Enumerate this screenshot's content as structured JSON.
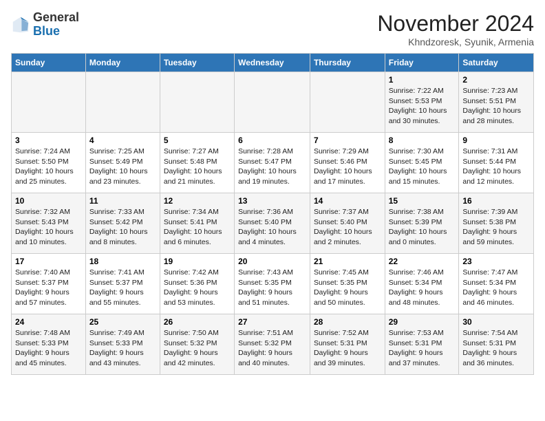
{
  "header": {
    "logo_general": "General",
    "logo_blue": "Blue",
    "month": "November 2024",
    "location": "Khndzoresk, Syunik, Armenia"
  },
  "columns": [
    "Sunday",
    "Monday",
    "Tuesday",
    "Wednesday",
    "Thursday",
    "Friday",
    "Saturday"
  ],
  "weeks": [
    [
      {
        "day": "",
        "info": ""
      },
      {
        "day": "",
        "info": ""
      },
      {
        "day": "",
        "info": ""
      },
      {
        "day": "",
        "info": ""
      },
      {
        "day": "",
        "info": ""
      },
      {
        "day": "1",
        "info": "Sunrise: 7:22 AM\nSunset: 5:53 PM\nDaylight: 10 hours and 30 minutes."
      },
      {
        "day": "2",
        "info": "Sunrise: 7:23 AM\nSunset: 5:51 PM\nDaylight: 10 hours and 28 minutes."
      }
    ],
    [
      {
        "day": "3",
        "info": "Sunrise: 7:24 AM\nSunset: 5:50 PM\nDaylight: 10 hours and 25 minutes."
      },
      {
        "day": "4",
        "info": "Sunrise: 7:25 AM\nSunset: 5:49 PM\nDaylight: 10 hours and 23 minutes."
      },
      {
        "day": "5",
        "info": "Sunrise: 7:27 AM\nSunset: 5:48 PM\nDaylight: 10 hours and 21 minutes."
      },
      {
        "day": "6",
        "info": "Sunrise: 7:28 AM\nSunset: 5:47 PM\nDaylight: 10 hours and 19 minutes."
      },
      {
        "day": "7",
        "info": "Sunrise: 7:29 AM\nSunset: 5:46 PM\nDaylight: 10 hours and 17 minutes."
      },
      {
        "day": "8",
        "info": "Sunrise: 7:30 AM\nSunset: 5:45 PM\nDaylight: 10 hours and 15 minutes."
      },
      {
        "day": "9",
        "info": "Sunrise: 7:31 AM\nSunset: 5:44 PM\nDaylight: 10 hours and 12 minutes."
      }
    ],
    [
      {
        "day": "10",
        "info": "Sunrise: 7:32 AM\nSunset: 5:43 PM\nDaylight: 10 hours and 10 minutes."
      },
      {
        "day": "11",
        "info": "Sunrise: 7:33 AM\nSunset: 5:42 PM\nDaylight: 10 hours and 8 minutes."
      },
      {
        "day": "12",
        "info": "Sunrise: 7:34 AM\nSunset: 5:41 PM\nDaylight: 10 hours and 6 minutes."
      },
      {
        "day": "13",
        "info": "Sunrise: 7:36 AM\nSunset: 5:40 PM\nDaylight: 10 hours and 4 minutes."
      },
      {
        "day": "14",
        "info": "Sunrise: 7:37 AM\nSunset: 5:40 PM\nDaylight: 10 hours and 2 minutes."
      },
      {
        "day": "15",
        "info": "Sunrise: 7:38 AM\nSunset: 5:39 PM\nDaylight: 10 hours and 0 minutes."
      },
      {
        "day": "16",
        "info": "Sunrise: 7:39 AM\nSunset: 5:38 PM\nDaylight: 9 hours and 59 minutes."
      }
    ],
    [
      {
        "day": "17",
        "info": "Sunrise: 7:40 AM\nSunset: 5:37 PM\nDaylight: 9 hours and 57 minutes."
      },
      {
        "day": "18",
        "info": "Sunrise: 7:41 AM\nSunset: 5:37 PM\nDaylight: 9 hours and 55 minutes."
      },
      {
        "day": "19",
        "info": "Sunrise: 7:42 AM\nSunset: 5:36 PM\nDaylight: 9 hours and 53 minutes."
      },
      {
        "day": "20",
        "info": "Sunrise: 7:43 AM\nSunset: 5:35 PM\nDaylight: 9 hours and 51 minutes."
      },
      {
        "day": "21",
        "info": "Sunrise: 7:45 AM\nSunset: 5:35 PM\nDaylight: 9 hours and 50 minutes."
      },
      {
        "day": "22",
        "info": "Sunrise: 7:46 AM\nSunset: 5:34 PM\nDaylight: 9 hours and 48 minutes."
      },
      {
        "day": "23",
        "info": "Sunrise: 7:47 AM\nSunset: 5:34 PM\nDaylight: 9 hours and 46 minutes."
      }
    ],
    [
      {
        "day": "24",
        "info": "Sunrise: 7:48 AM\nSunset: 5:33 PM\nDaylight: 9 hours and 45 minutes."
      },
      {
        "day": "25",
        "info": "Sunrise: 7:49 AM\nSunset: 5:33 PM\nDaylight: 9 hours and 43 minutes."
      },
      {
        "day": "26",
        "info": "Sunrise: 7:50 AM\nSunset: 5:32 PM\nDaylight: 9 hours and 42 minutes."
      },
      {
        "day": "27",
        "info": "Sunrise: 7:51 AM\nSunset: 5:32 PM\nDaylight: 9 hours and 40 minutes."
      },
      {
        "day": "28",
        "info": "Sunrise: 7:52 AM\nSunset: 5:31 PM\nDaylight: 9 hours and 39 minutes."
      },
      {
        "day": "29",
        "info": "Sunrise: 7:53 AM\nSunset: 5:31 PM\nDaylight: 9 hours and 37 minutes."
      },
      {
        "day": "30",
        "info": "Sunrise: 7:54 AM\nSunset: 5:31 PM\nDaylight: 9 hours and 36 minutes."
      }
    ]
  ]
}
